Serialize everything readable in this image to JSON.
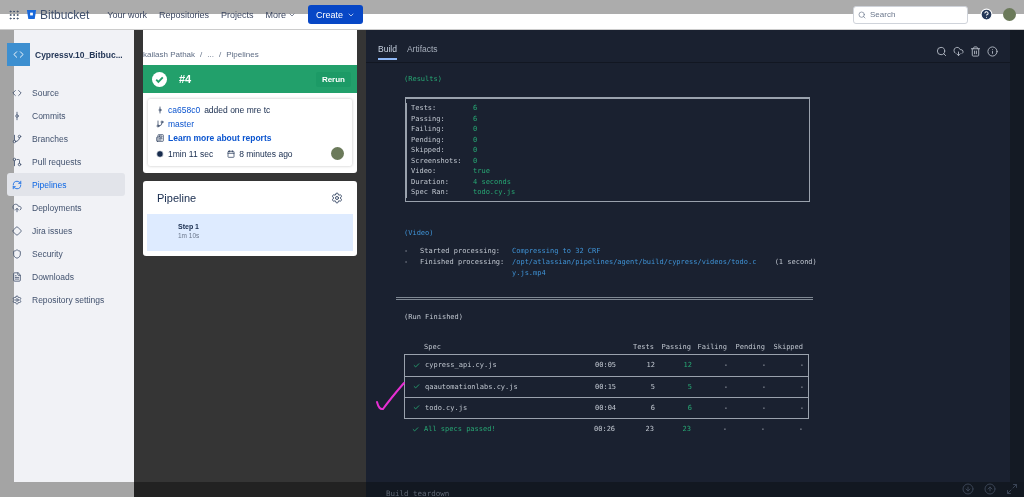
{
  "top_nav": {
    "logo": "Bitbucket",
    "items": [
      "Your work",
      "Repositories",
      "Projects",
      "More"
    ],
    "create": "Create",
    "search": {
      "placeholder": "Search"
    }
  },
  "sidebar": {
    "repo": "Cypressv.10_Bitbuc...",
    "items": [
      {
        "kind": "source",
        "label": "Source",
        "selected": false
      },
      {
        "kind": "commits",
        "label": "Commits",
        "selected": false
      },
      {
        "kind": "branches",
        "label": "Branches",
        "selected": false
      },
      {
        "kind": "pulls",
        "label": "Pull requests",
        "selected": false
      },
      {
        "kind": "pipelines",
        "label": "Pipelines",
        "selected": true
      },
      {
        "kind": "deployments",
        "label": "Deployments",
        "selected": false
      },
      {
        "kind": "jira",
        "label": "Jira issues",
        "selected": false
      },
      {
        "kind": "security",
        "label": "Security",
        "selected": false
      },
      {
        "kind": "downloads",
        "label": "Downloads",
        "selected": false
      },
      {
        "kind": "settings",
        "label": "Repository settings",
        "selected": false
      }
    ]
  },
  "breadcrumb": [
    "kailash Pathak",
    "/",
    "...",
    "/",
    "Pipelines"
  ],
  "run": {
    "number": "#4",
    "passed": true,
    "rerun": "Rerun",
    "commit": "ca658c0",
    "message": "added one mre tc",
    "branch": "master",
    "reports_link": "Learn more about reports",
    "duration": "1min 11 sec",
    "started": "8 minutes ago"
  },
  "pipeline": {
    "title": "Pipeline",
    "steps": [
      {
        "name": "Step 1",
        "duration": "1m 10s",
        "selected": true
      }
    ]
  },
  "log_tabs": [
    {
      "label": "Build",
      "selected": true
    },
    {
      "label": "Artifacts",
      "selected": false
    }
  ],
  "log": {
    "results_heading": "(Results)",
    "results": [
      {
        "label": "Tests:",
        "value": "6"
      },
      {
        "label": "Passing:",
        "value": "6"
      },
      {
        "label": "Failing:",
        "value": "0"
      },
      {
        "label": "Pending:",
        "value": "0"
      },
      {
        "label": "Skipped:",
        "value": "0"
      },
      {
        "label": "Screenshots:",
        "value": "0"
      },
      {
        "label": "Video:",
        "value": "true"
      },
      {
        "label": "Duration:",
        "value": "4 seconds"
      },
      {
        "label": "Spec Ran:",
        "value": "todo.cy.js"
      }
    ],
    "video_heading": "(Video)",
    "video_lines": [
      {
        "bullet": "-",
        "label": "Started processing:",
        "value": "Compressing to 32 CRF"
      },
      {
        "bullet": "-",
        "label": "Finished processing:",
        "value": "/opt/atlassian/pipelines/agent/build/cypress/videos/todo.cy.js.mp4",
        "note": "(1 second)"
      }
    ],
    "run_heading": "(Run Finished)",
    "spec_columns": [
      "Spec",
      "Tests",
      "Passing",
      "Failing",
      "Pending",
      "Skipped"
    ],
    "specs": [
      {
        "name": "cypress_api.cy.js",
        "passed": true,
        "time": "00:05",
        "tests": "12",
        "passing": "12",
        "failing": "-",
        "pending": "-",
        "skipped": "-"
      },
      {
        "name": "qaautomationlabs.cy.js",
        "passed": true,
        "time": "00:15",
        "tests": "5",
        "passing": "5",
        "failing": "-",
        "pending": "-",
        "skipped": "-"
      },
      {
        "name": "todo.cy.js",
        "passed": true,
        "time": "00:04",
        "tests": "6",
        "passing": "6",
        "failing": "-",
        "pending": "-",
        "skipped": "-"
      }
    ],
    "summary": {
      "name": "All specs passed!",
      "passed": true,
      "time": "00:26",
      "tests": "23",
      "passing": "23",
      "failing": "-",
      "pending": "-",
      "skipped": "-"
    }
  },
  "footer": {
    "step": "Build teardown"
  }
}
